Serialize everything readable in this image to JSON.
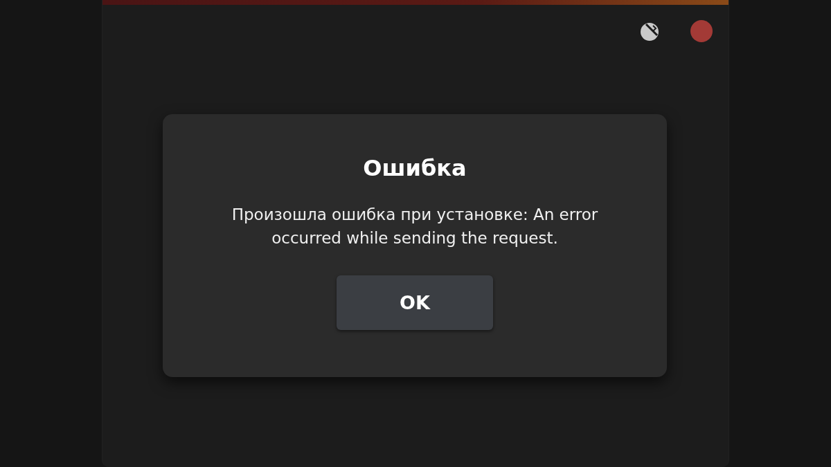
{
  "dialog": {
    "title": "Ошибка",
    "message": "Произошла ошибка при установке: An error occurred while sending the request.",
    "buttons": [
      "OK"
    ]
  }
}
